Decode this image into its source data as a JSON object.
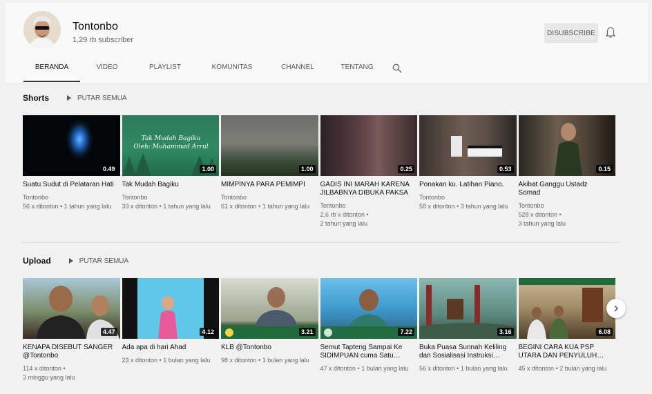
{
  "channel": {
    "name": "Tontonbo",
    "subscribers": "1,29 rb subscriber",
    "subscribe_label": "DISUBSCRIBE"
  },
  "tabs": [
    {
      "label": "BERANDA",
      "active": true
    },
    {
      "label": "VIDEO"
    },
    {
      "label": "PLAYLIST"
    },
    {
      "label": "KOMUNITAS"
    },
    {
      "label": "CHANNEL"
    },
    {
      "label": "TENTANG"
    }
  ],
  "icons": {
    "search": "search-icon",
    "bell": "bell-icon",
    "next": "chevron-right-icon",
    "play": "play-icon"
  },
  "sections": {
    "shorts": {
      "title": "Shorts",
      "play_all": "PUTAR SEMUA",
      "videos": [
        {
          "title": "Suatu Sudut di Pelataran Hati",
          "duration": "0.49",
          "meta": [
            "Tontonbo",
            "56 x ditonton • 1 tahun yang lalu"
          ]
        },
        {
          "title": "Tak Mudah Bagiku",
          "duration": "1.00",
          "overlay": "Tak Mudah Bagiku\nOleh: Muhammad Arrul",
          "meta": [
            "Tontonbo",
            "33 x ditonton • 1 tahun yang lalu"
          ]
        },
        {
          "title": "MIMPINYA PARA PEMIMPI",
          "duration": "1.00",
          "meta": [
            "Tontonbo",
            "61 x ditonton • 1 tahun yang lalu"
          ]
        },
        {
          "title": "GADIS INI MARAH KARENA JILBABNYA DIBUKA PAKSA",
          "duration": "0.25",
          "meta": [
            "Tontonbo",
            "2,6 rb x ditonton •",
            "2 tahun yang lalu"
          ]
        },
        {
          "title": "Ponakan ku. Latihan Piano.",
          "duration": "0.53",
          "meta": [
            "Tontonbo",
            "58 x ditonton • 3 tahun yang lalu"
          ]
        },
        {
          "title": "Akibat Ganggu Ustadz Somad",
          "duration": "0.15",
          "meta": [
            "Tontonbo",
            "528 x ditonton •",
            "3 tahun yang lalu"
          ]
        }
      ]
    },
    "upload": {
      "title": "Upload",
      "play_all": "PUTAR SEMUA",
      "videos": [
        {
          "title": "KENAPA DISEBUT SANGER @Tontonbo",
          "duration": "4.47",
          "meta": [
            "114 x ditonton •",
            "3 minggu yang lalu"
          ]
        },
        {
          "title": "Ada apa di hari Ahad",
          "duration": "4.12",
          "meta": [
            "23 x ditonton • 1 bulan yang lalu"
          ]
        },
        {
          "title": "KLB @Tontonbo",
          "duration": "3.21",
          "meta": [
            "98 x ditonton • 1 bulan yang lalu"
          ]
        },
        {
          "title": "Semut Tapteng Sampai Ke SIDIMPUAN cuma Satu…",
          "duration": "7.22",
          "meta": [
            "47 x ditonton • 1 bulan yang lalu"
          ]
        },
        {
          "title": "Buka Puasa Sunnah Keliling dan Sosialisasi Instruksi…",
          "duration": "3.16",
          "meta": [
            "56 x ditonton • 1 bulan yang lalu"
          ]
        },
        {
          "title": "BEGINI CARA KUA PSP UTARA DAN PENYULUH…",
          "duration": "6.08",
          "meta": [
            "45 x ditonton • 2 bulan yang lalu"
          ]
        }
      ]
    }
  }
}
